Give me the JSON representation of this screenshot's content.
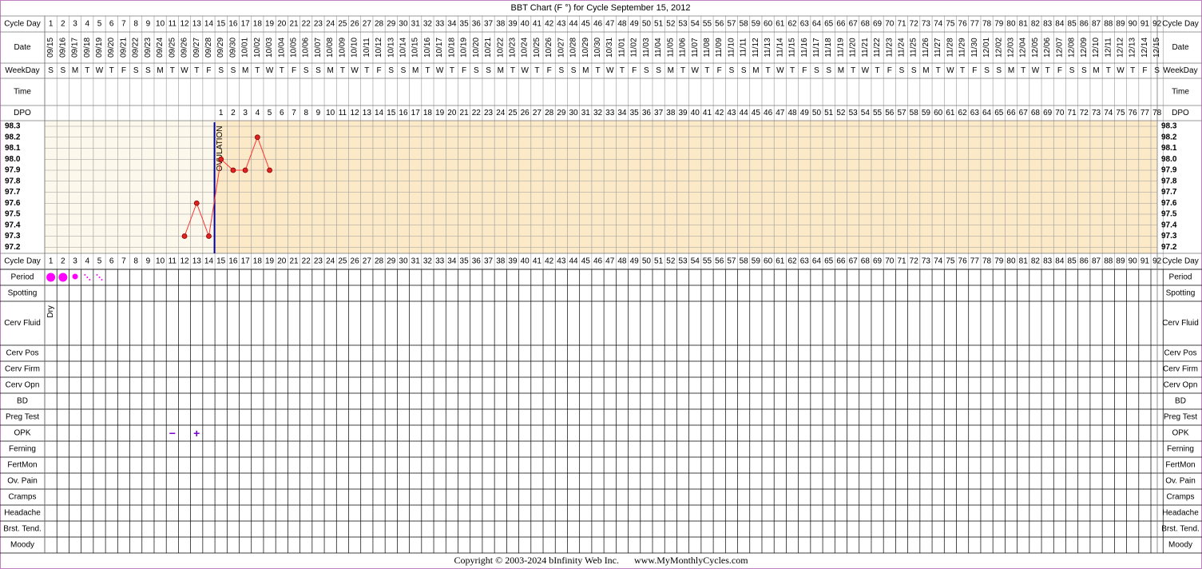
{
  "title": "BBT Chart (F °) for Cycle September 15, 2012",
  "colors": {
    "page_border": "#c080c0",
    "grid": "#999999",
    "pre_ovulation_bg": "#fdf8ec",
    "post_ovulation_bg": "#fbe9c8",
    "temp_line": "#ff3333",
    "temp_point": "#dd2222",
    "ovulation_line": "#000099",
    "period": "#ff00ff",
    "opk": "#7700cc"
  },
  "row_labels": {
    "cycle_day": "Cycle Day",
    "date": "Date",
    "weekday": "WeekDay",
    "time": "Time",
    "dpo": "DPO",
    "period": "Period",
    "spotting": "Spotting",
    "cerv_fluid": "Cerv Fluid",
    "cerv_pos": "Cerv Pos",
    "cerv_firm": "Cerv Firm",
    "cerv_opn": "Cerv Opn",
    "bd": "BD",
    "preg_test": "Preg Test",
    "opk": "OPK",
    "ferning": "Ferning",
    "fertmon": "FertMon",
    "ov_pain": "Ov. Pain",
    "cramps": "Cramps",
    "headache": "Headache",
    "brst_tend": "Brst. Tend.",
    "moody": "Moody"
  },
  "ovulation_label": "OVULATION",
  "cerv_fluid_entries": [
    {
      "day": 1,
      "text": "Dry"
    }
  ],
  "opk_entries": [
    {
      "day": 11,
      "text": "−"
    },
    {
      "day": 13,
      "text": "+"
    }
  ],
  "period_entries": [
    {
      "day": 1,
      "kind": "heavy"
    },
    {
      "day": 2,
      "kind": "heavy"
    },
    {
      "day": 3,
      "kind": "medium"
    },
    {
      "day": 4,
      "kind": "light"
    },
    {
      "day": 5,
      "kind": "light"
    }
  ],
  "copyright": "Copyright © 2003-2024 bInfinity Web Inc.",
  "website": "www.MyMonthlyCycles.com",
  "chart_data": {
    "type": "line",
    "title": "BBT Chart (F °) for Cycle September 15, 2012",
    "cycle_days": [
      1,
      2,
      3,
      4,
      5,
      6,
      7,
      8,
      9,
      10,
      11,
      12,
      13,
      14,
      15,
      16,
      17,
      18,
      19,
      20,
      21,
      22,
      23,
      24,
      25,
      26,
      27,
      28,
      29,
      30,
      31,
      32,
      33,
      34,
      35,
      36,
      37,
      38,
      39,
      40,
      41,
      42,
      43,
      44,
      45,
      46,
      47,
      48,
      49,
      50,
      51,
      52,
      53,
      54,
      55,
      56,
      57,
      58,
      59,
      60,
      61,
      62,
      63,
      64,
      65,
      66,
      67,
      68,
      69,
      70,
      71,
      72,
      73,
      74,
      75,
      76,
      77,
      78,
      79,
      80,
      81,
      82,
      83,
      84,
      85,
      86,
      87,
      88,
      89,
      90,
      91,
      92
    ],
    "dates": [
      "09/15",
      "09/16",
      "09/17",
      "09/18",
      "09/19",
      "09/20",
      "09/21",
      "09/22",
      "09/23",
      "09/24",
      "09/25",
      "09/26",
      "09/27",
      "09/28",
      "09/29",
      "09/30",
      "10/01",
      "10/02",
      "10/03",
      "10/04",
      "10/05",
      "10/06",
      "10/07",
      "10/08",
      "10/09",
      "10/10",
      "10/11",
      "10/12",
      "10/13",
      "10/14",
      "10/15",
      "10/16",
      "10/17",
      "10/18",
      "10/19",
      "10/20",
      "10/21",
      "10/22",
      "10/23",
      "10/24",
      "10/25",
      "10/26",
      "10/27",
      "10/28",
      "10/29",
      "10/30",
      "10/31",
      "11/01",
      "11/02",
      "11/03",
      "11/04",
      "11/05",
      "11/06",
      "11/07",
      "11/08",
      "11/09",
      "11/10",
      "11/11",
      "11/12",
      "11/13",
      "11/14",
      "11/15",
      "11/16",
      "11/17",
      "11/18",
      "11/19",
      "11/20",
      "11/21",
      "11/22",
      "11/23",
      "11/24",
      "11/25",
      "11/26",
      "11/27",
      "11/28",
      "11/29",
      "11/30",
      "12/01",
      "12/02",
      "12/03",
      "12/04",
      "12/05",
      "12/06",
      "12/07",
      "12/08",
      "12/09",
      "12/10",
      "12/11",
      "12/12",
      "12/13",
      "12/14",
      "12/15"
    ],
    "weekdays": [
      "S",
      "S",
      "M",
      "T",
      "W",
      "T",
      "F",
      "S",
      "S",
      "M",
      "T",
      "W",
      "T",
      "F",
      "S",
      "S",
      "M",
      "T",
      "W",
      "T",
      "F",
      "S",
      "S",
      "M",
      "T",
      "W",
      "T",
      "F",
      "S",
      "S",
      "M",
      "T",
      "W",
      "T",
      "F",
      "S",
      "S",
      "M",
      "T",
      "W",
      "T",
      "F",
      "S",
      "S",
      "M",
      "T",
      "W",
      "T",
      "F",
      "S",
      "S",
      "M",
      "T",
      "W",
      "T",
      "F",
      "S",
      "S",
      "M",
      "T",
      "W",
      "T",
      "F",
      "S",
      "S",
      "M",
      "T",
      "W",
      "T",
      "F",
      "S",
      "S",
      "M",
      "T",
      "W",
      "T",
      "F",
      "S",
      "S",
      "M",
      "T",
      "W",
      "T",
      "F",
      "S",
      "S",
      "M",
      "T",
      "W",
      "T",
      "F",
      "S"
    ],
    "dpo_start_day": 15,
    "dpo_count": 78,
    "ovulation_day": 14,
    "y_ticks": [
      "98.3",
      "98.2",
      "98.1",
      "98.0",
      "97.9",
      "97.8",
      "97.7",
      "97.6",
      "97.5",
      "97.4",
      "97.3",
      "97.2"
    ],
    "ylim": [
      97.2,
      98.3
    ],
    "temperatures": [
      {
        "day": 12,
        "value": 97.3
      },
      {
        "day": 13,
        "value": 97.6
      },
      {
        "day": 14,
        "value": 97.3
      },
      {
        "day": 15,
        "value": 98.0
      },
      {
        "day": 16,
        "value": 97.9
      },
      {
        "day": 17,
        "value": 97.9
      },
      {
        "day": 18,
        "value": 98.2
      },
      {
        "day": 19,
        "value": 97.9
      }
    ]
  }
}
